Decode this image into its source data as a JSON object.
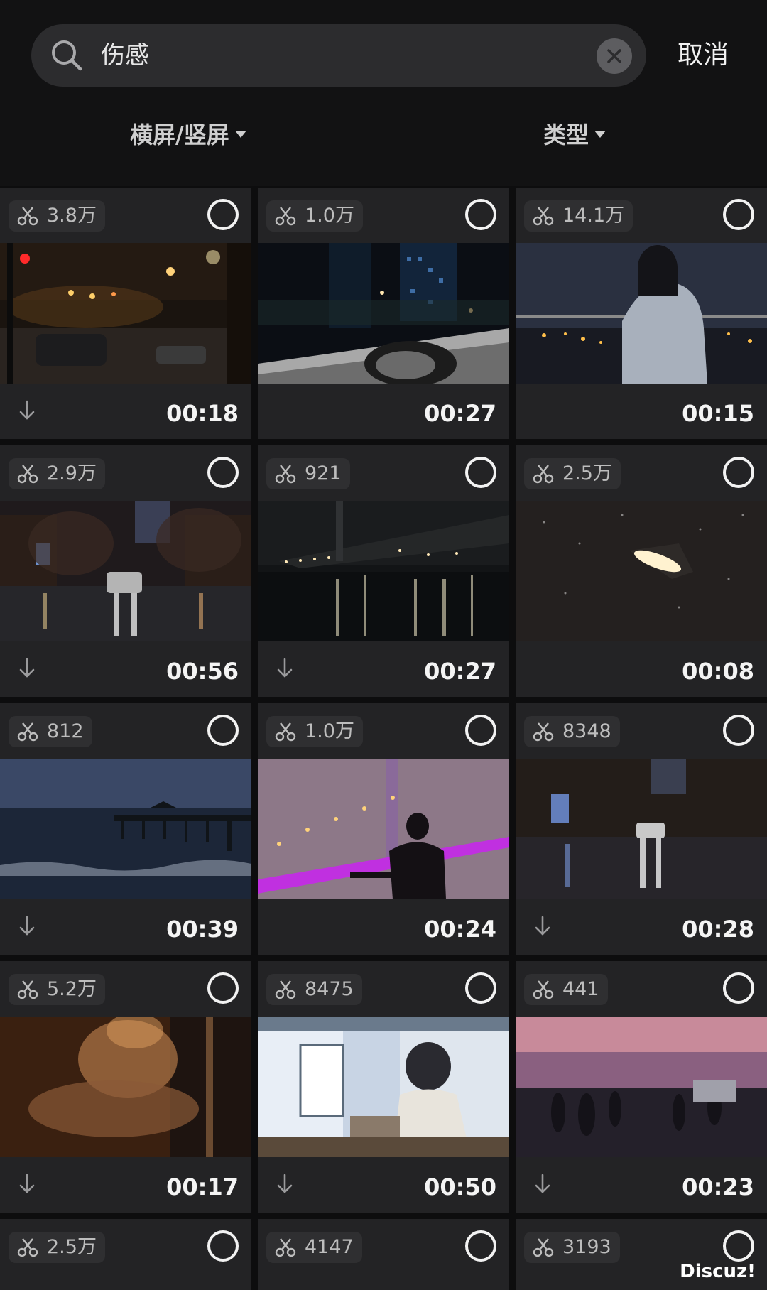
{
  "search": {
    "query": "伤感",
    "cancel_label": "取消"
  },
  "filters": [
    {
      "label": "横屏/竖屏"
    },
    {
      "label": "类型"
    }
  ],
  "videos": [
    {
      "uses": "3.8万",
      "duration": "00:18",
      "downloadable": true,
      "scene": "night-street"
    },
    {
      "uses": "1.0万",
      "duration": "00:27",
      "downloadable": false,
      "scene": "car-window-city"
    },
    {
      "uses": "14.1万",
      "duration": "00:15",
      "downloadable": false,
      "scene": "girl-rooftop-night"
    },
    {
      "uses": "2.9万",
      "duration": "00:56",
      "downloadable": true,
      "scene": "rainy-street"
    },
    {
      "uses": "921",
      "duration": "00:27",
      "downloadable": true,
      "scene": "bridge-river-night"
    },
    {
      "uses": "2.5万",
      "duration": "00:08",
      "downloadable": false,
      "scene": "rain-streetlamp"
    },
    {
      "uses": "812",
      "duration": "00:39",
      "downloadable": true,
      "scene": "sea-pier-dusk"
    },
    {
      "uses": "1.0万",
      "duration": "00:24",
      "downloadable": false,
      "scene": "guitar-bridge"
    },
    {
      "uses": "8348",
      "duration": "00:28",
      "downloadable": true,
      "scene": "rainy-street-car"
    },
    {
      "uses": "5.2万",
      "duration": "00:17",
      "downloadable": true,
      "scene": "blurred-person-window"
    },
    {
      "uses": "8475",
      "duration": "00:50",
      "downloadable": true,
      "scene": "anime-boy-desk"
    },
    {
      "uses": "441",
      "duration": "00:23",
      "downloadable": true,
      "scene": "sunset-promenade"
    },
    {
      "uses": "2.5万",
      "duration": "",
      "downloadable": false,
      "scene": ""
    },
    {
      "uses": "4147",
      "duration": "",
      "downloadable": false,
      "scene": ""
    },
    {
      "uses": "3193",
      "duration": "",
      "downloadable": false,
      "scene": ""
    }
  ],
  "watermark": "Discuz!"
}
